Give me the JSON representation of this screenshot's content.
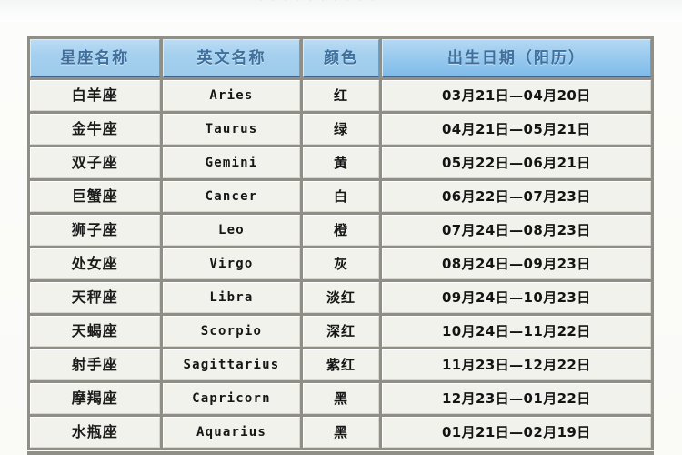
{
  "page": {
    "top_fragment": "· · · · ·   · ·   · · ·"
  },
  "table": {
    "headers": {
      "name": "星座名称",
      "english": "英文名称",
      "color": "颜色",
      "date": "出生日期（阳历）"
    },
    "header_bg": "#a5d0ee",
    "header_text_color": "#3f6f9c",
    "cell_bg": "#f2f2ec",
    "grid_color": "#8f8f88",
    "rows": [
      {
        "name": "白羊座",
        "english": "Aries",
        "color": "红",
        "date": "03月21日—04月20日"
      },
      {
        "name": "金牛座",
        "english": "Taurus",
        "color": "绿",
        "date": "04月21日—05月21日"
      },
      {
        "name": "双子座",
        "english": "Gemini",
        "color": "黄",
        "date": "05月22日—06月21日"
      },
      {
        "name": "巨蟹座",
        "english": "Cancer",
        "color": "白",
        "date": "06月22日—07月23日"
      },
      {
        "name": "狮子座",
        "english": "Leo",
        "color": "橙",
        "date": "07月24日—08月23日"
      },
      {
        "name": "处女座",
        "english": "Virgo",
        "color": "灰",
        "date": "08月24日—09月23日"
      },
      {
        "name": "天秤座",
        "english": "Libra",
        "color": "淡红",
        "date": "09月24日—10月23日"
      },
      {
        "name": "天蝎座",
        "english": "Scorpio",
        "color": "深红",
        "date": "10月24日—11月22日"
      },
      {
        "name": "射手座",
        "english": "Sagittarius",
        "color": "紫红",
        "date": "11月23日—12月22日"
      },
      {
        "name": "摩羯座",
        "english": "Capricorn",
        "color": "黑",
        "date": "12月23日—01月22日"
      },
      {
        "name": "水瓶座",
        "english": "Aquarius",
        "color": "黑",
        "date": "01月21日—02月19日"
      }
    ]
  }
}
